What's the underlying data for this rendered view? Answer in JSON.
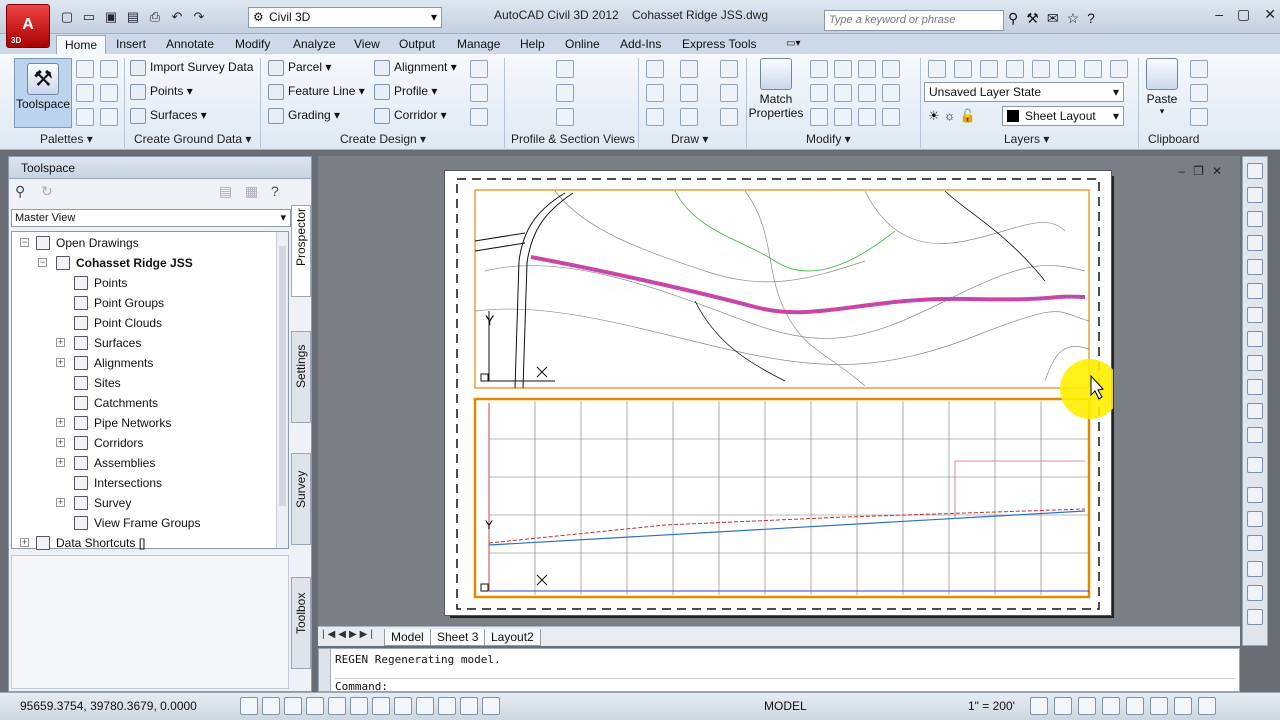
{
  "titlebar": {
    "app_letter": "A",
    "app_badge": "3D",
    "workspace": "Civil 3D",
    "app_title": "AutoCAD Civil 3D 2012",
    "file_name": "Cohasset Ridge JSS.dwg",
    "search_placeholder": "Type a keyword or phrase"
  },
  "tabs": [
    "Home",
    "Insert",
    "Annotate",
    "Modify",
    "Analyze",
    "View",
    "Output",
    "Manage",
    "Help",
    "Online",
    "Add-Ins",
    "Express Tools"
  ],
  "ribbon": {
    "palettes": {
      "toolspace_label": "Toolspace",
      "title": "Palettes"
    },
    "ground": {
      "items": [
        "Import Survey Data",
        "Points",
        "Surfaces"
      ],
      "title": "Create Ground Data"
    },
    "design": {
      "items": [
        "Parcel",
        "Feature Line",
        "Grading",
        "Alignment",
        "Profile",
        "Corridor"
      ],
      "title": "Create Design"
    },
    "profile_section": {
      "title": "Profile & Section Views"
    },
    "draw": {
      "title": "Draw"
    },
    "modify": {
      "match_label_1": "Match",
      "match_label_2": "Properties",
      "title": "Modify"
    },
    "layers": {
      "layer_state": "Unsaved Layer State",
      "current_layer": "Sheet Layout",
      "title": "Layers"
    },
    "clipboard": {
      "paste_label": "Paste",
      "title": "Clipboard"
    }
  },
  "toolspace": {
    "title": "Toolspace",
    "view": "Master View",
    "tree": {
      "open_drawings": "Open Drawings",
      "drawing": "Cohasset Ridge JSS",
      "items": [
        "Points",
        "Point Groups",
        "Point Clouds",
        "Surfaces",
        "Alignments",
        "Sites",
        "Catchments",
        "Pipe Networks",
        "Corridors",
        "Assemblies",
        "Intersections",
        "Survey",
        "View Frame Groups"
      ],
      "data_shortcuts": "Data Shortcuts []"
    },
    "vertical_tabs": [
      "Prospector",
      "Settings",
      "Survey",
      "Toolbox"
    ]
  },
  "layout_tabs": [
    "Model",
    "Sheet 3",
    "Layout2"
  ],
  "command": {
    "history": "REGEN Regenerating model.",
    "prompt": "Command:"
  },
  "status": {
    "coordinates": "95659.3754, 39780.3679, 0.0000",
    "space": "MODEL",
    "scale": "1\" = 200'"
  }
}
